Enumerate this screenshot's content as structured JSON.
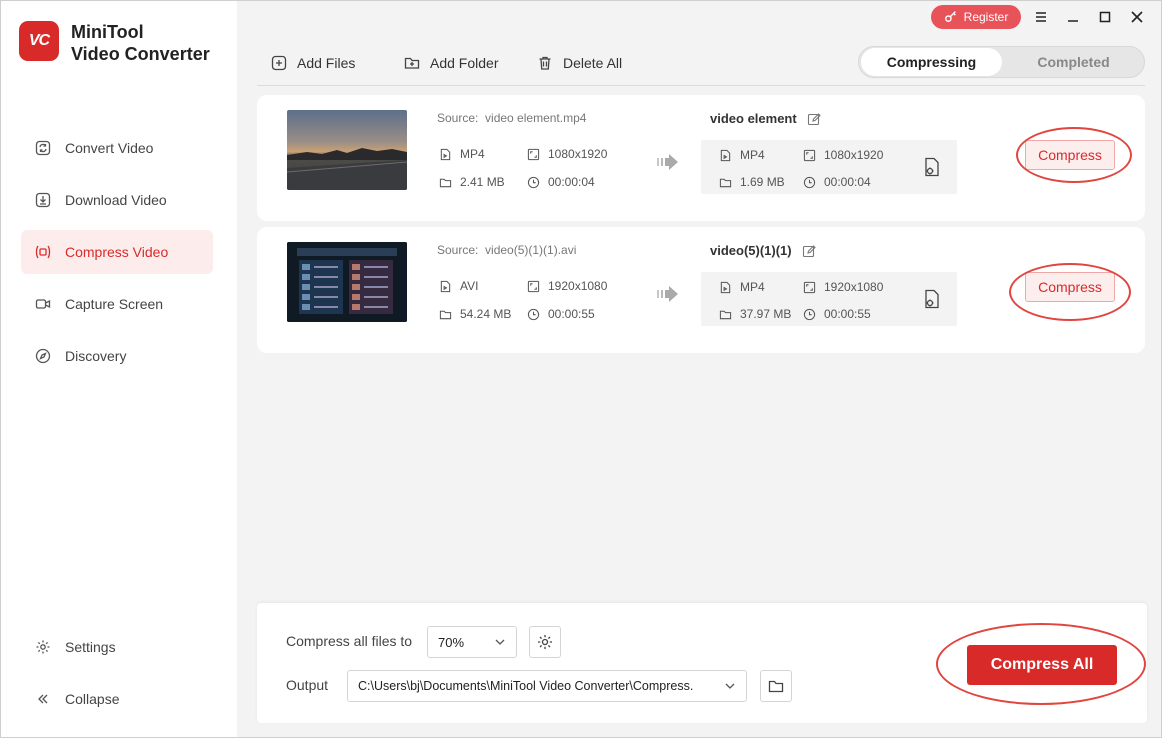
{
  "app": {
    "logo_text": "VC",
    "name_line1": "MiniTool",
    "name_line2": "Video Converter"
  },
  "titlebar": {
    "register_label": "Register"
  },
  "sidebar": {
    "items": [
      {
        "label": "Convert Video",
        "icon": "convert-icon"
      },
      {
        "label": "Download Video",
        "icon": "download-icon"
      },
      {
        "label": "Compress Video",
        "icon": "compress-icon",
        "active": true
      },
      {
        "label": "Capture Screen",
        "icon": "camera-icon"
      },
      {
        "label": "Discovery",
        "icon": "compass-icon"
      }
    ],
    "settings_label": "Settings",
    "collapse_label": "Collapse"
  },
  "toolbar": {
    "add_files": "Add Files",
    "add_folder": "Add Folder",
    "delete_all": "Delete All"
  },
  "tabs": {
    "compressing": "Compressing",
    "completed": "Completed"
  },
  "files": [
    {
      "source_label": "Source:",
      "source_name": "video element.mp4",
      "format": "MP4",
      "resolution": "1080x1920",
      "size": "2.41 MB",
      "duration": "00:00:04",
      "output_name": "video element",
      "out_format": "MP4",
      "out_resolution": "1080x1920",
      "out_size": "1.69 MB",
      "out_duration": "00:00:04",
      "compress_label": "Compress"
    },
    {
      "source_label": "Source:",
      "source_name": "video(5)(1)(1).avi",
      "format": "AVI",
      "resolution": "1920x1080",
      "size": "54.24 MB",
      "duration": "00:00:55",
      "output_name": "video(5)(1)(1)",
      "out_format": "MP4",
      "out_resolution": "1920x1080",
      "out_size": "37.97 MB",
      "out_duration": "00:00:55",
      "compress_label": "Compress"
    }
  ],
  "bottom": {
    "compress_all_files_to_label": "Compress all files to",
    "ratio_value": "70%",
    "output_label": "Output",
    "output_path": "C:\\Users\\bj\\Documents\\MiniTool Video Converter\\Compress.",
    "compress_all_label": "Compress All"
  },
  "colors": {
    "accent": "#d92a2a",
    "register": "#e8535a",
    "ring": "#e0463f"
  }
}
